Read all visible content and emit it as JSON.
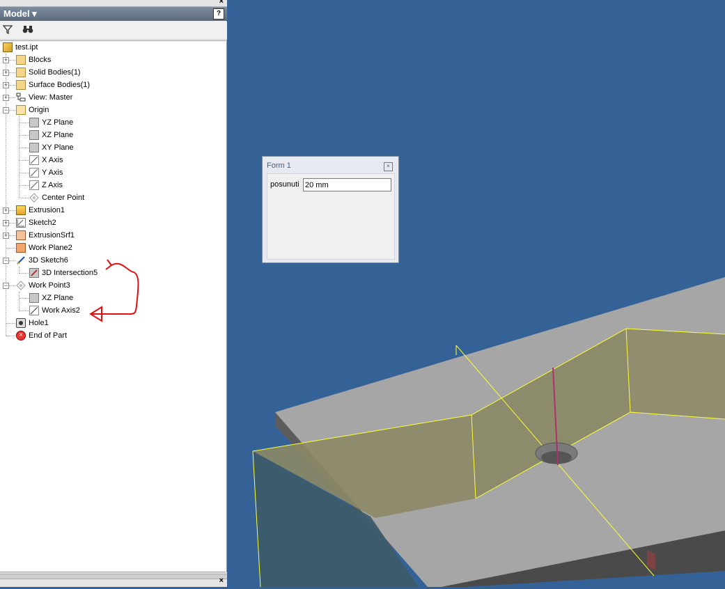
{
  "panel": {
    "title": "Model",
    "help_icon": "help-icon",
    "toolbar": {
      "filter_icon": "filter-icon",
      "find_icon": "binoculars-icon"
    }
  },
  "tree": [
    {
      "label": "test.ipt",
      "icon": "part-icon"
    },
    {
      "label": "Blocks",
      "icon": "blocks-folder-icon"
    },
    {
      "label": "Solid Bodies(1)",
      "icon": "solid-bodies-folder-icon"
    },
    {
      "label": "Surface Bodies(1)",
      "icon": "surface-bodies-folder-icon"
    },
    {
      "label": "View: Master",
      "icon": "view-icon"
    },
    {
      "label": "Origin",
      "icon": "open-folder-icon"
    },
    {
      "label": "YZ Plane",
      "icon": "plane-icon"
    },
    {
      "label": "XZ Plane",
      "icon": "plane-icon"
    },
    {
      "label": "XY Plane",
      "icon": "plane-icon"
    },
    {
      "label": "X Axis",
      "icon": "axis-icon"
    },
    {
      "label": "Y Axis",
      "icon": "axis-icon"
    },
    {
      "label": "Z Axis",
      "icon": "axis-icon"
    },
    {
      "label": "Center Point",
      "icon": "point-icon"
    },
    {
      "label": "Extrusion1",
      "icon": "extrusion-icon"
    },
    {
      "label": "Sketch2",
      "icon": "sketch-icon"
    },
    {
      "label": "ExtrusionSrf1",
      "icon": "surface-extrusion-icon"
    },
    {
      "label": "Work Plane2",
      "icon": "work-plane-icon"
    },
    {
      "label": "3D Sketch6",
      "icon": "3d-sketch-icon"
    },
    {
      "label": "3D Intersection5",
      "icon": "3d-intersection-icon"
    },
    {
      "label": "Work Point3",
      "icon": "point-icon"
    },
    {
      "label": "XZ Plane",
      "icon": "plane-icon"
    },
    {
      "label": "Work Axis2",
      "icon": "axis-icon"
    },
    {
      "label": "Hole1",
      "icon": "hole-icon"
    },
    {
      "label": "End of Part",
      "icon": "end-of-part-icon"
    }
  ],
  "form": {
    "title": "Form 1",
    "field_label": "posunuti",
    "field_value": "20 mm"
  },
  "colors": {
    "viewport_bg": "#356296",
    "part_top": "#a6a6a6",
    "part_side": "#5c5c5c",
    "surface_fill": "#8c8a66",
    "edge_yellow": "#ffff33",
    "annotation_red": "#e01010"
  }
}
